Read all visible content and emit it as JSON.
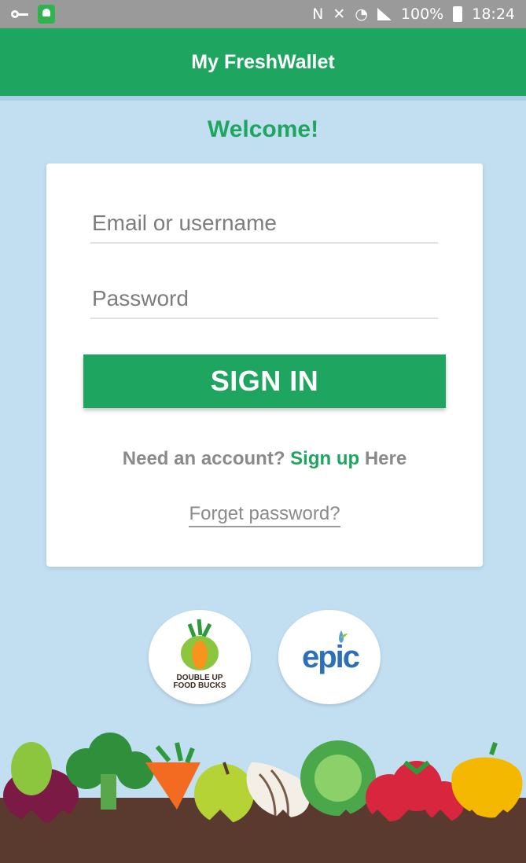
{
  "status_bar": {
    "battery": "100%",
    "time": "18:24"
  },
  "app_bar": {
    "title": "My FreshWallet"
  },
  "welcome": "Welcome!",
  "login": {
    "email_placeholder": "Email or username",
    "password_placeholder": "Password",
    "sign_in_label": "SIGN IN",
    "account_prompt": "Need an account?",
    "sign_up_link": "Sign up",
    "sign_up_suffix": "Here",
    "forgot_password": "Forget password?"
  },
  "logos": {
    "double_up_line1": "DOUBLE UP",
    "double_up_line2": "FOOD BUCKS",
    "epic": "epic"
  },
  "colors": {
    "brand_green": "#1ea55f",
    "background": "#c2dff2"
  }
}
